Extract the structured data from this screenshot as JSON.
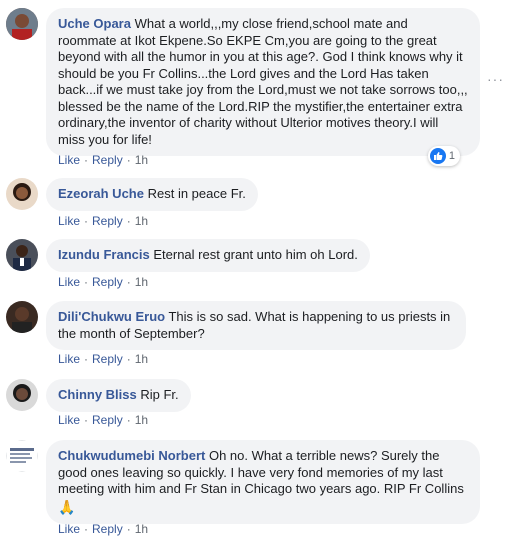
{
  "comments": [
    {
      "author": "Uche Opara",
      "text": "What a world,,,my close friend,school mate and roommate at Ikot Ekpene.So EKPE Cm,you are going to the great beyond with all the humor in you at this age?. God I think knows why it should be you Fr Collins...the Lord gives and the Lord Has taken back...if we must take joy from the Lord,must we not take sorrows too,,, blessed be the name of the Lord.RIP the mystifier,the entertainer extra ordinary,the inventor of charity without Ulterior motives theory.I will miss you for life!",
      "like": "Like",
      "reply": "Reply",
      "time": "1h",
      "reaction_count": "1"
    },
    {
      "author": "Ezeorah Uche",
      "text": "Rest in peace Fr.",
      "like": "Like",
      "reply": "Reply",
      "time": "1h"
    },
    {
      "author": "Izundu Francis",
      "text": "Eternal rest grant unto him oh Lord.",
      "like": "Like",
      "reply": "Reply",
      "time": "1h"
    },
    {
      "author": "Dili'Chukwu Eruo",
      "text": "This is so sad. What is happening to us priests in the month of September?",
      "like": "Like",
      "reply": "Reply",
      "time": "1h"
    },
    {
      "author": "Chinny Bliss",
      "text": "Rip Fr.",
      "like": "Like",
      "reply": "Reply",
      "time": "1h"
    },
    {
      "author": "Chukwudumebi Norbert",
      "text": "Oh no. What a terrible news? Surely the good ones leaving so quickly. I have very fond memories of my last meeting with him and Fr Stan in Chicago two years ago. RIP Fr Collins",
      "emoji": "🙏",
      "like": "Like",
      "reply": "Reply",
      "time": "1h"
    }
  ],
  "more_options": "···",
  "colors": {
    "author": "#385898",
    "bubble": "#f2f3f5",
    "meta": "#606770",
    "like_badge": "#1877f2"
  },
  "icons": {
    "reaction": "thumbs-up-icon",
    "more": "more-options-icon",
    "prayer": "folded-hands-emoji"
  }
}
